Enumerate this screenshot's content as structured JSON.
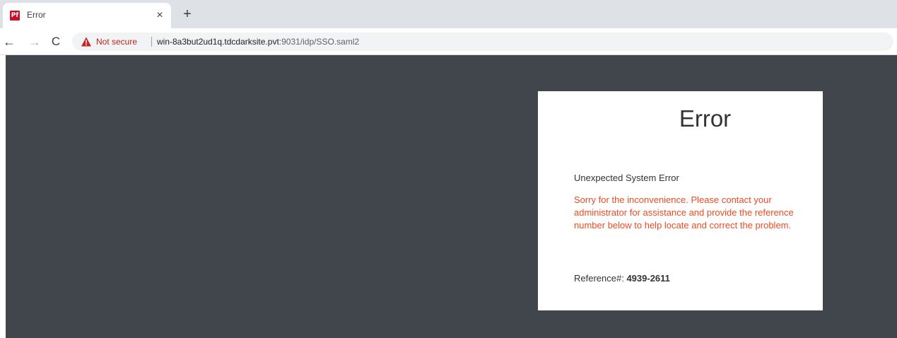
{
  "browser": {
    "tab": {
      "favicon_text": "Pf",
      "title": "Error",
      "close_glyph": "×",
      "new_tab_glyph": "+"
    },
    "toolbar": {
      "back_glyph": "←",
      "forward_glyph": "→",
      "reload_glyph": "C",
      "security_label": "Not secure",
      "url_host": "win-8a3but2ud1q.tdcdarksite.pvt",
      "url_path": ":9031/idp/SSO.saml2"
    }
  },
  "page": {
    "title": "Error",
    "subtitle": "Unexpected System Error",
    "message": "Sorry for the inconvenience. Please contact your administrator for assistance and provide the reference number below to help locate and correct the problem.",
    "reference_label": "Reference#:",
    "reference_number": "4939-2611"
  },
  "colors": {
    "page_background": "#41464d",
    "error_text": "#ee4b22",
    "insecure_warning": "#c5221f",
    "favicon": "#c8102e"
  },
  "icons": {
    "warning": "warning-triangle-icon",
    "favicon": "pingfederate-favicon-icon"
  }
}
